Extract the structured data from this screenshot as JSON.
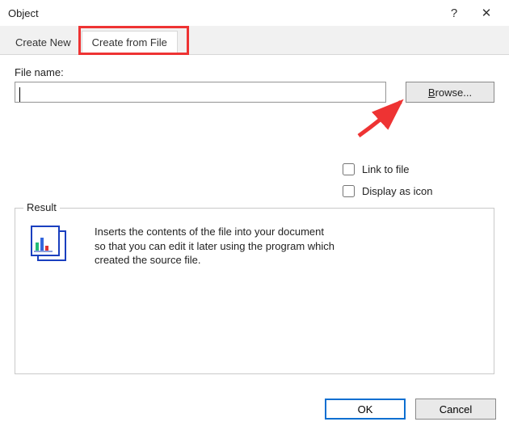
{
  "window": {
    "title": "Object",
    "help_glyph": "?",
    "close_glyph": "✕"
  },
  "tabs": {
    "create_new": "Create New",
    "create_from_file": "Create from File"
  },
  "form": {
    "file_name_label": "File name:",
    "file_name_value": "",
    "browse_label_prefix": "B",
    "browse_label_rest": "rowse...",
    "link_to_file": "Link to file",
    "display_as_icon": "Display as icon"
  },
  "result": {
    "legend": "Result",
    "description": "Inserts the contents of the file into your document so that you can edit it later using the program which created the source file."
  },
  "footer": {
    "ok": "OK",
    "cancel": "Cancel"
  }
}
